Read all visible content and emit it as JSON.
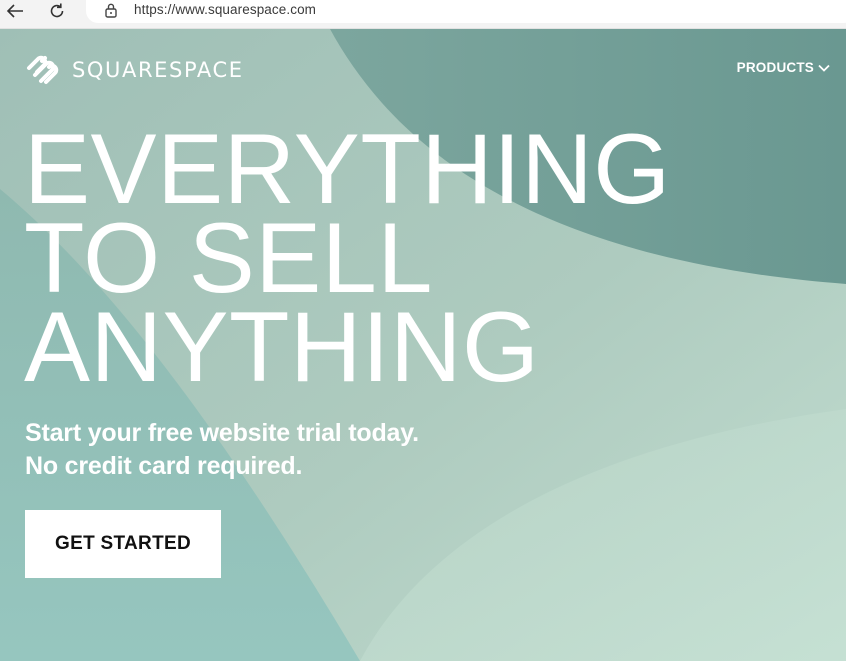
{
  "browser": {
    "url": "https://www.squarespace.com",
    "back_icon": "arrow-left-icon",
    "reload_icon": "reload-icon",
    "lock_icon": "lock-icon"
  },
  "header": {
    "logo_text": "SQUARESPACE",
    "nav_products": "PRODUCTS"
  },
  "hero": {
    "headline": [
      "EVERYTHING",
      "TO SELL",
      "ANYTHING"
    ],
    "subheadline": [
      "Start your free website trial today.",
      "No credit card required."
    ],
    "cta_label": "GET STARTED"
  },
  "colors": {
    "hero_base": "#a8c9bf",
    "hero_dark": "#6e9a93",
    "hero_light": "#c3ded1",
    "text_on_hero": "#ffffff",
    "cta_bg": "#ffffff",
    "cta_text": "#111111"
  }
}
